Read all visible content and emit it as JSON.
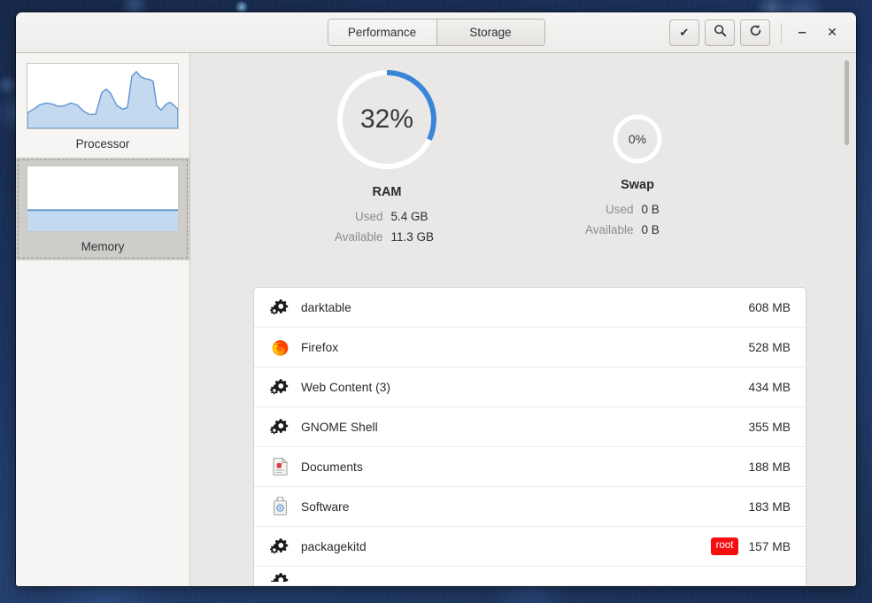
{
  "window": {
    "tabs": [
      {
        "label": "Performance",
        "active": true
      },
      {
        "label": "Storage",
        "active": false
      }
    ],
    "header_buttons": [
      {
        "name": "confirm-button",
        "icon": "check-icon"
      },
      {
        "name": "search-button",
        "icon": "search-icon"
      },
      {
        "name": "refresh-button",
        "icon": "refresh-icon"
      }
    ],
    "window_controls": [
      {
        "name": "minimize-button",
        "icon": "minimize-icon"
      },
      {
        "name": "close-button",
        "icon": "close-icon"
      }
    ]
  },
  "sidebar": {
    "items": [
      {
        "label": "Processor",
        "selected": false,
        "graph": "area-spiky"
      },
      {
        "label": "Memory",
        "selected": true,
        "graph": "flat-fill"
      }
    ]
  },
  "gauges": {
    "ram": {
      "title": "RAM",
      "percent": "32%",
      "percent_value": 32,
      "used_label": "Used",
      "used_value": "5.4 GB",
      "available_label": "Available",
      "available_value": "11.3 GB"
    },
    "swap": {
      "title": "Swap",
      "percent": "0%",
      "percent_value": 0,
      "used_label": "Used",
      "used_value": "0 B",
      "available_label": "Available",
      "available_value": "0 B"
    }
  },
  "processes": [
    {
      "name": "darktable",
      "icon": "cogs-icon",
      "memory": "608 MB",
      "badge": ""
    },
    {
      "name": "Firefox",
      "icon": "firefox-icon",
      "memory": "528 MB",
      "badge": ""
    },
    {
      "name": "Web Content (3)",
      "icon": "cogs-icon",
      "memory": "434 MB",
      "badge": ""
    },
    {
      "name": "GNOME Shell",
      "icon": "cogs-icon",
      "memory": "355 MB",
      "badge": ""
    },
    {
      "name": "Documents",
      "icon": "document-icon",
      "memory": "188 MB",
      "badge": ""
    },
    {
      "name": "Software",
      "icon": "software-icon",
      "memory": "183 MB",
      "badge": ""
    },
    {
      "name": "packagekitd",
      "icon": "cogs-icon",
      "memory": "157 MB",
      "badge": "root"
    }
  ],
  "colors": {
    "accent_blue": "#3a85d8",
    "graph_fill": "#c3d9f0",
    "badge_red": "#f30f0f",
    "window_bg": "#ebebe9",
    "content_bg": "#e9e8e6"
  }
}
